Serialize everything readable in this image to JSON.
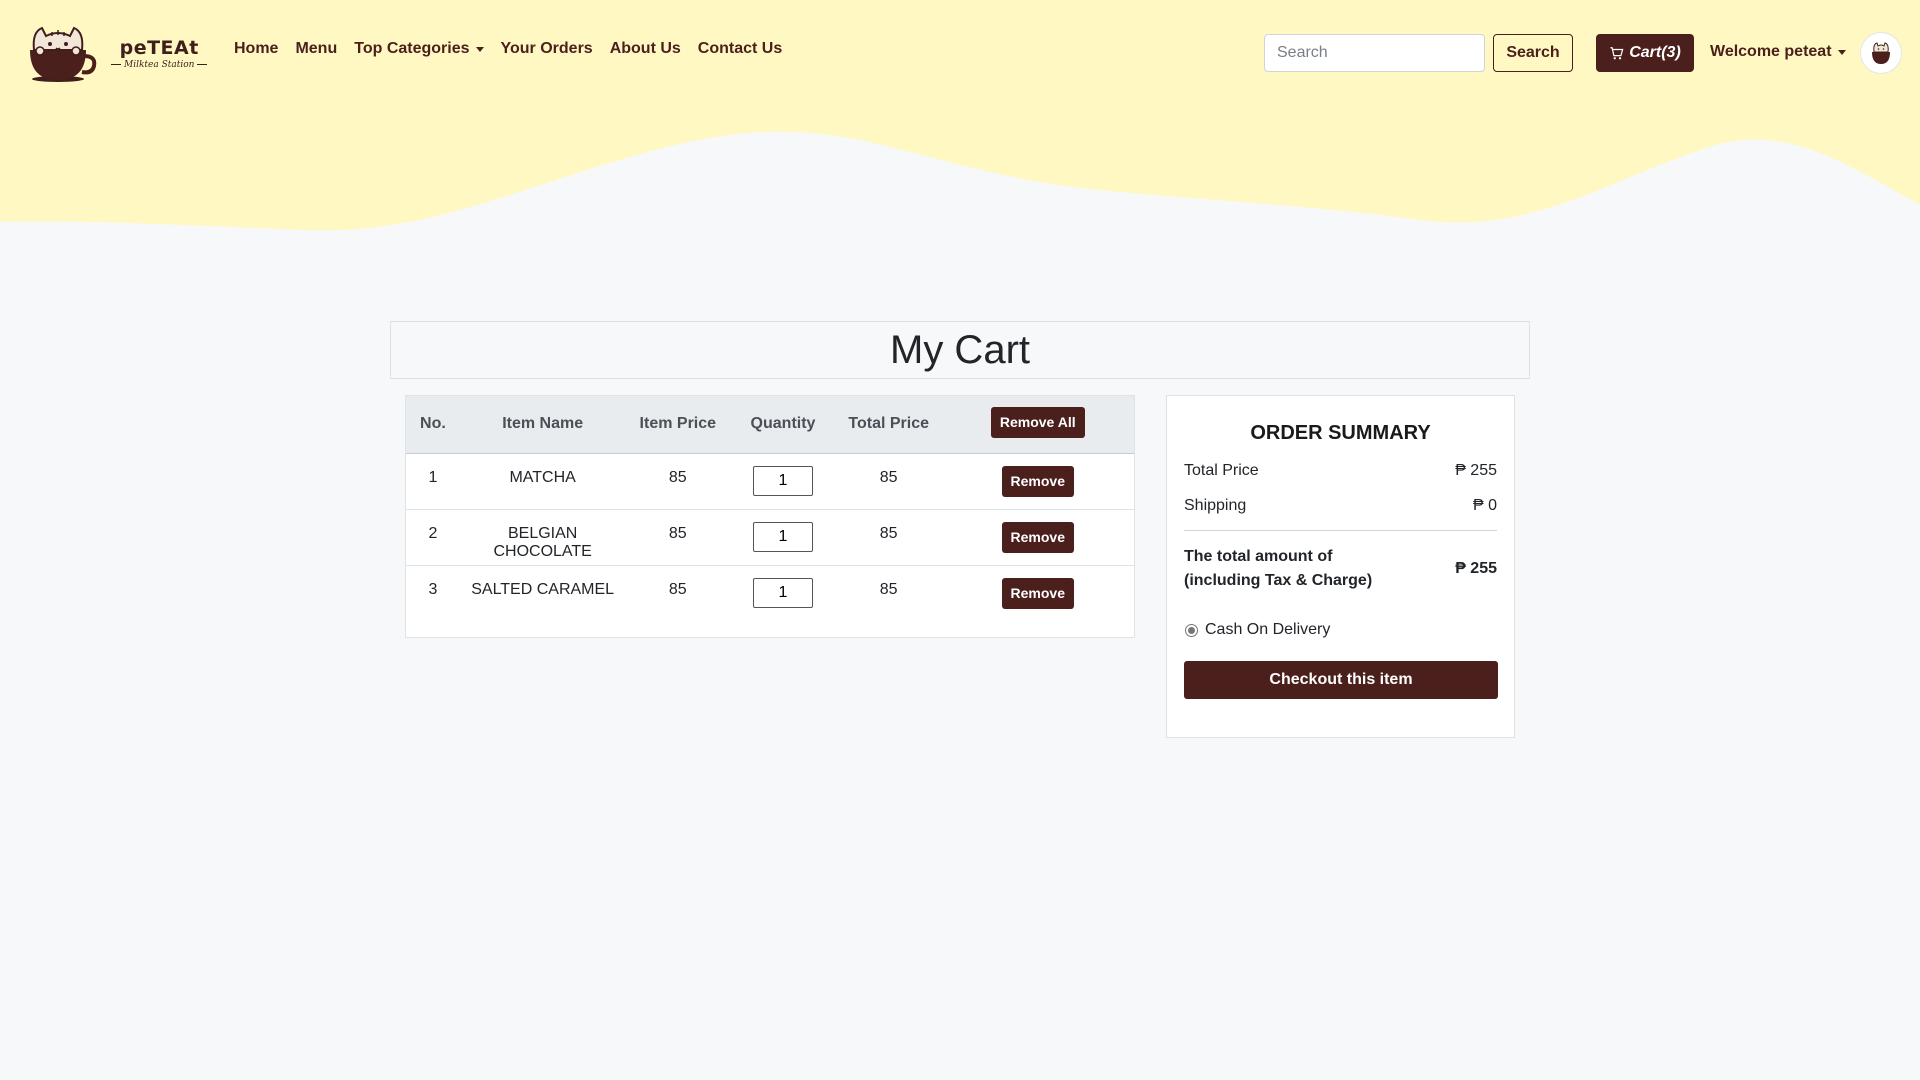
{
  "brand": {
    "name": "peTEAt",
    "subtitle": "Milktea Station"
  },
  "nav": {
    "items": [
      {
        "label": "Home"
      },
      {
        "label": "Menu"
      },
      {
        "label": "Top Categories"
      },
      {
        "label": "Your Orders"
      },
      {
        "label": "About Us"
      },
      {
        "label": "Contact Us"
      }
    ]
  },
  "search": {
    "placeholder": "Search",
    "value": "",
    "button_label": "Search"
  },
  "cart_button": {
    "label": "Cart(3)"
  },
  "user": {
    "welcome": "Welcome peteat"
  },
  "page": {
    "title": "My Cart"
  },
  "cart_table": {
    "headers": [
      "No.",
      "Item Name",
      "Item Price",
      "Quantity",
      "Total Price"
    ],
    "remove_all_label": "Remove All",
    "remove_label": "Remove",
    "rows": [
      {
        "no": "1",
        "name": "MATCHA",
        "price": "85",
        "quantity": "1",
        "total": "85"
      },
      {
        "no": "2",
        "name": "BELGIAN CHOCOLATE",
        "price": "85",
        "quantity": "1",
        "total": "85"
      },
      {
        "no": "3",
        "name": "SALTED CARAMEL",
        "price": "85",
        "quantity": "1",
        "total": "85"
      }
    ]
  },
  "summary": {
    "title": "ORDER SUMMARY",
    "total_price_label": "Total Price",
    "total_price_value": "₱ 255",
    "shipping_label": "Shipping",
    "shipping_value": "₱ 0",
    "grand_total_label_line1": "The total amount of",
    "grand_total_label_line2": "(including Tax & Charge)",
    "grand_total_value": "₱ 255",
    "payment_method": "Cash On Delivery",
    "checkout_label": "Checkout this item"
  },
  "colors": {
    "header_bg": "#fff8c2",
    "accent": "#4a1f1c",
    "page_bg": "#f7f8fa"
  }
}
